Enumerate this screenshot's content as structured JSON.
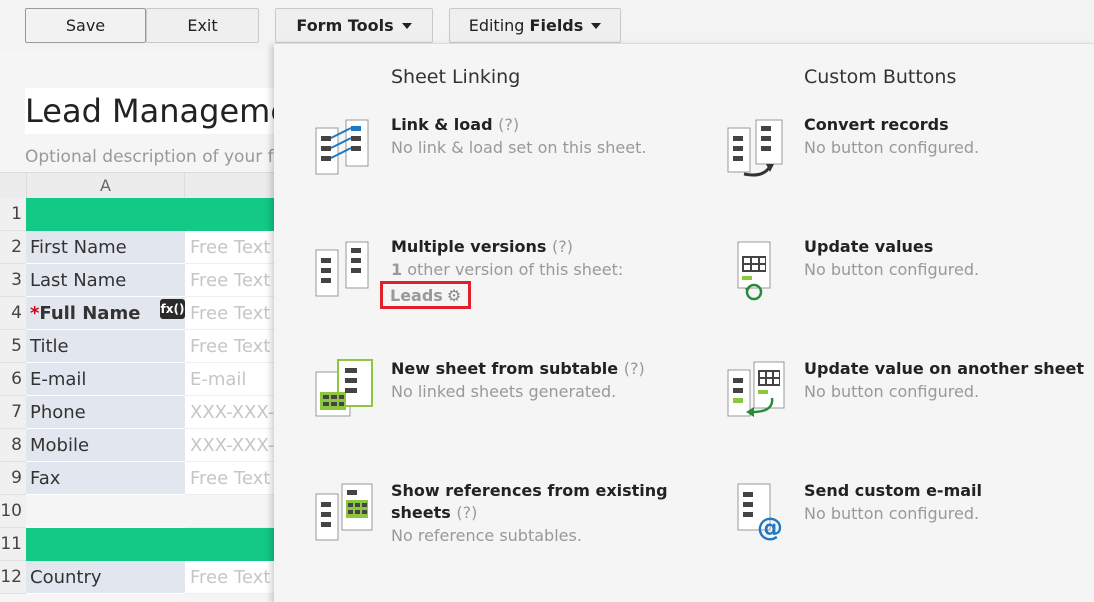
{
  "toolbar": {
    "save_label": "Save",
    "exit_label": "Exit",
    "form_tools_label": "Form Tools",
    "editing_prefix": "Editing",
    "editing_bold": "Fields"
  },
  "form": {
    "title": "Lead Management",
    "description": "Optional description of your form",
    "column_header": "A",
    "rows": [
      {
        "num": "1",
        "type": "header"
      },
      {
        "num": "2",
        "label": "First Name",
        "placeholder": "Free Text"
      },
      {
        "num": "3",
        "label": "Last Name",
        "placeholder": "Free Text"
      },
      {
        "num": "4",
        "label": "Full Name",
        "required_mark": "*",
        "fx": "fx()",
        "placeholder": "Free Text"
      },
      {
        "num": "5",
        "label": "Title",
        "placeholder": "Free Text"
      },
      {
        "num": "6",
        "label": "E-mail",
        "placeholder": "E-mail"
      },
      {
        "num": "7",
        "label": "Phone",
        "placeholder": "XXX-XXX-XXXX"
      },
      {
        "num": "8",
        "label": "Mobile",
        "placeholder": "XXX-XXX-XXXX"
      },
      {
        "num": "9",
        "label": "Fax",
        "placeholder": "Free Text"
      },
      {
        "num": "10",
        "type": "empty"
      },
      {
        "num": "11",
        "type": "header"
      },
      {
        "num": "12",
        "label": "Country",
        "placeholder": "Free Text"
      }
    ]
  },
  "panel": {
    "sheet_linking_title": "Sheet Linking",
    "custom_buttons_title": "Custom Buttons",
    "help_mark": "(?)",
    "items_left": [
      {
        "title": "Link & load",
        "desc": "No link & load set on this sheet."
      },
      {
        "title": "Multiple versions",
        "desc_count": "1",
        "desc_rest": " other version of this sheet:",
        "link": "Leads"
      },
      {
        "title": "New sheet from subtable",
        "desc": "No linked sheets generated."
      },
      {
        "title_line1": "Show references from existing",
        "title_line2": "sheets",
        "desc": "No reference subtables."
      }
    ],
    "items_right": [
      {
        "title": "Convert records",
        "desc": "No button configured."
      },
      {
        "title": "Update values",
        "desc": "No button configured."
      },
      {
        "title": "Update value on another sheet",
        "desc": "No button configured."
      },
      {
        "title": "Send custom e-mail",
        "desc": "No button configured."
      }
    ]
  },
  "colors": {
    "header_green": "#12c985",
    "highlight_red": "#e0202a",
    "icon_blue": "#1f78c1",
    "icon_green": "#8dc63f"
  }
}
